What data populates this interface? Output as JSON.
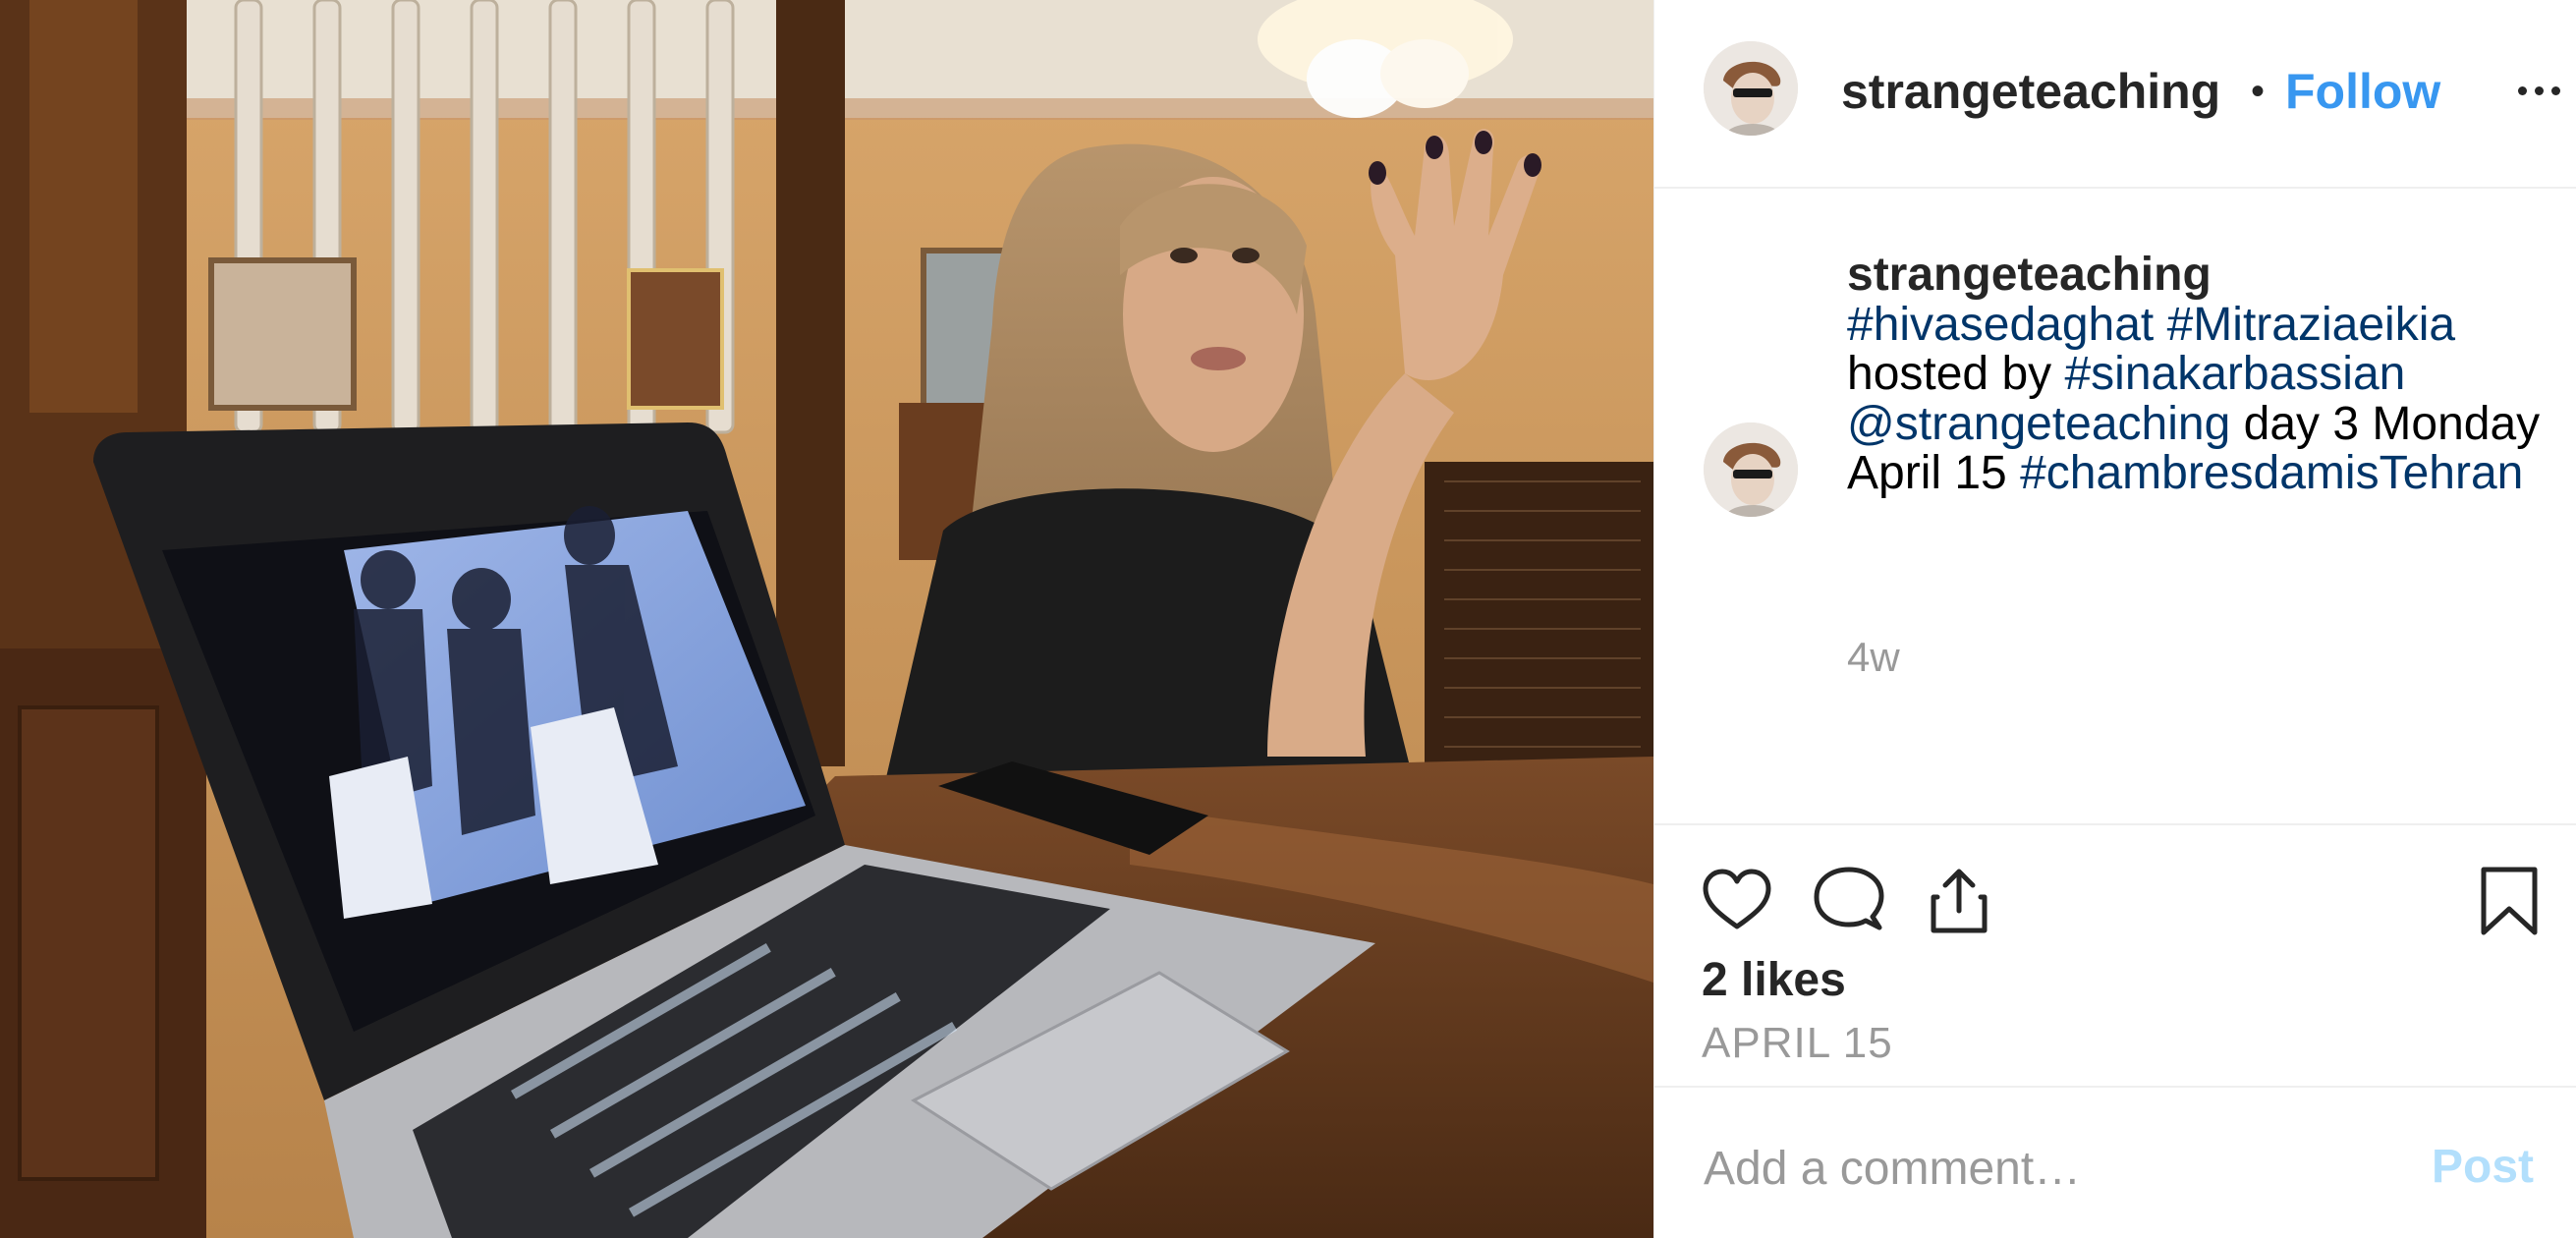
{
  "post": {
    "image_icon": "photo-of-woman-with-laptop"
  },
  "header": {
    "username": "strangeteaching",
    "separator": "•",
    "follow_label": "Follow",
    "more_icon": "more-horizontal-icon"
  },
  "caption": {
    "username": "strangeteaching",
    "parts": [
      {
        "text": "#hivasedaghat",
        "type": "hashtag"
      },
      {
        "text": " ",
        "type": "text"
      },
      {
        "text": "#Mitraziaeikia",
        "type": "hashtag"
      },
      {
        "text": " hosted by ",
        "type": "text"
      },
      {
        "text": "#sinakarbassian",
        "type": "hashtag"
      },
      {
        "text": " ",
        "type": "text"
      },
      {
        "text": "@strangeteaching",
        "type": "mention"
      },
      {
        "text": " day 3 Monday April 15 ",
        "type": "text"
      },
      {
        "text": "#chambresdamisTehran",
        "type": "hashtag"
      }
    ],
    "time_ago": "4w"
  },
  "actions": {
    "icons": [
      "heart-icon",
      "comment-icon",
      "share-icon",
      "bookmark-icon"
    ],
    "likes": "2 likes",
    "date": "APRIL 15"
  },
  "comment": {
    "placeholder": "Add a comment…",
    "post_label": "Post"
  },
  "colors": {
    "link": "#003569",
    "follow": "#3897f0",
    "muted": "#999999",
    "post_disabled": "#b2dffc"
  }
}
